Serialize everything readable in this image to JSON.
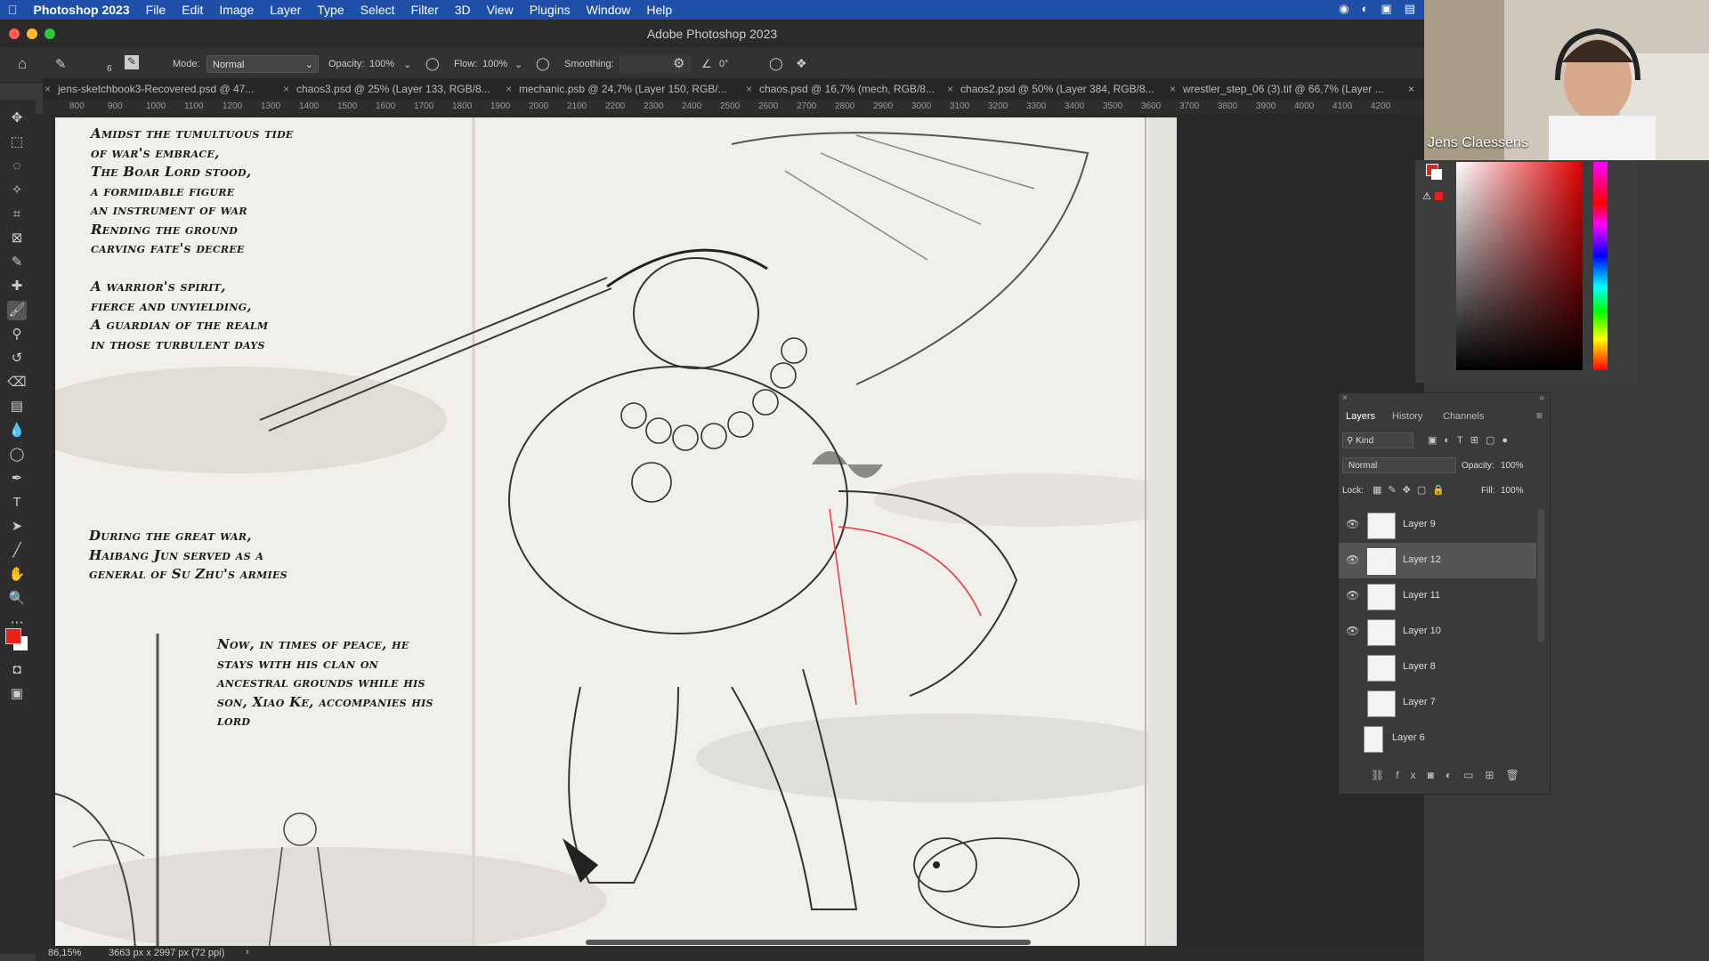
{
  "menubar": {
    "app": "Photoshop 2023",
    "items": [
      "File",
      "Edit",
      "Image",
      "Layer",
      "Type",
      "Select",
      "Filter",
      "3D",
      "View",
      "Plugins",
      "Window",
      "Help"
    ]
  },
  "window": {
    "title": "Adobe Photoshop 2023"
  },
  "options": {
    "brush_size": "6",
    "mode_label": "Mode:",
    "mode_value": "Normal",
    "opacity_label": "Opacity:",
    "opacity_value": "100%",
    "flow_label": "Flow:",
    "flow_value": "100%",
    "smoothing_label": "Smoothing:",
    "angle_value": "0°"
  },
  "tabs": [
    {
      "label": "jens-sketchbook3-Recovered.psd @ 47..."
    },
    {
      "label": "chaos3.psd @ 25% (Layer 133, RGB/8..."
    },
    {
      "label": "mechanic.psb @ 24,7% (Layer 150, RGB/..."
    },
    {
      "label": "chaos.psd @ 16,7% (mech, RGB/8..."
    },
    {
      "label": "chaos2.psd @ 50% (Layer 384, RGB/8..."
    },
    {
      "label": "wrestler_step_06 (3).tif @ 66,7% (Layer ..."
    }
  ],
  "ruler_ticks": [
    "800",
    "900",
    "1000",
    "1100",
    "1200",
    "1300",
    "1400",
    "1500",
    "1600",
    "1700",
    "1800",
    "1900",
    "2000",
    "2100",
    "2200",
    "2300",
    "2400",
    "2500",
    "2600",
    "2700",
    "2800",
    "2900",
    "3000",
    "3100",
    "3200",
    "3300",
    "3400",
    "3500",
    "3600",
    "3700",
    "3800",
    "3900",
    "4000",
    "4100",
    "4200"
  ],
  "poem": {
    "block1": [
      "Amidst the tumultuous tide",
      "of war's embrace,",
      "The Boar Lord stood,",
      "a formidable figure",
      "an instrument of war",
      "Rending the ground",
      "carving fate's decree"
    ],
    "block2": [
      "A warrior's spirit,",
      "fierce and unyielding,",
      "A guardian of the realm",
      "in those turbulent days"
    ],
    "block3": [
      "During the great war,",
      "Haibang Jun served as a",
      "general of Su Zhu's armies"
    ],
    "block4": [
      "Now, in times of peace, he",
      "stays with his clan on",
      "ancestral grounds while his",
      "son, Xiao Ke, accompanies his",
      "lord"
    ]
  },
  "status": {
    "zoom": "86,15%",
    "doc_info": "3663 px x 2997 px (72 ppi)"
  },
  "webcam": {
    "name": "Jens Claessens"
  },
  "layers_panel": {
    "tabs": [
      "Layers",
      "History",
      "Channels"
    ],
    "kind_label": "Kind",
    "blend_mode": "Normal",
    "opacity_label": "Opacity:",
    "opacity_value": "100%",
    "lock_label": "Lock:",
    "fill_label": "Fill:",
    "fill_value": "100%",
    "layers": [
      {
        "name": "Layer 9",
        "visible": true,
        "selected": false
      },
      {
        "name": "Layer 12",
        "visible": true,
        "selected": true
      },
      {
        "name": "Layer 11",
        "visible": true,
        "selected": false
      },
      {
        "name": "Layer 10",
        "visible": true,
        "selected": false
      },
      {
        "name": "Layer 8",
        "visible": false,
        "selected": false
      },
      {
        "name": "Layer 7",
        "visible": false,
        "selected": false
      },
      {
        "name": "Layer 6",
        "visible": false,
        "selected": false
      }
    ]
  },
  "colors": {
    "foreground": "#e8211b",
    "background": "#ffffff",
    "menubar": "#1f4fa8"
  },
  "icons": {
    "toolbar": [
      "move-icon",
      "marquee-icon",
      "lasso-icon",
      "magic-wand-icon",
      "crop-icon",
      "frame-icon",
      "eyedropper-icon",
      "healing-icon",
      "brush-icon",
      "stamp-icon",
      "history-brush-icon",
      "eraser-icon",
      "gradient-icon",
      "blur-icon",
      "dodge-icon",
      "pen-icon",
      "type-icon",
      "path-select-icon",
      "line-icon",
      "hand-icon",
      "zoom-icon",
      "more-icon"
    ]
  }
}
